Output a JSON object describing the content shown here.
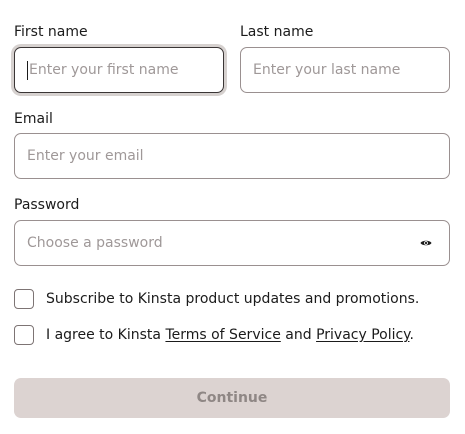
{
  "first_name": {
    "label": "First name",
    "placeholder": "Enter your first name"
  },
  "last_name": {
    "label": "Last name",
    "placeholder": "Enter your last name"
  },
  "email": {
    "label": "Email",
    "placeholder": "Enter your email"
  },
  "password": {
    "label": "Password",
    "placeholder": "Choose a password",
    "toggle_icon": "eye-icon"
  },
  "subscribe": {
    "text": "Subscribe to Kinsta product updates and promotions.",
    "checked": false
  },
  "agree": {
    "prefix": "I agree to Kinsta ",
    "terms_link": "Terms of Service",
    "middle": " and ",
    "privacy_link": "Privacy Policy",
    "suffix": ".",
    "checked": false
  },
  "continue_button": {
    "label": "Continue",
    "disabled": true
  },
  "colors": {
    "border": "#9a9090",
    "focus_ring": "#d6d1cf",
    "button_bg": "#dcd3d1",
    "button_text": "#8f8785",
    "placeholder": "#9f9898"
  }
}
